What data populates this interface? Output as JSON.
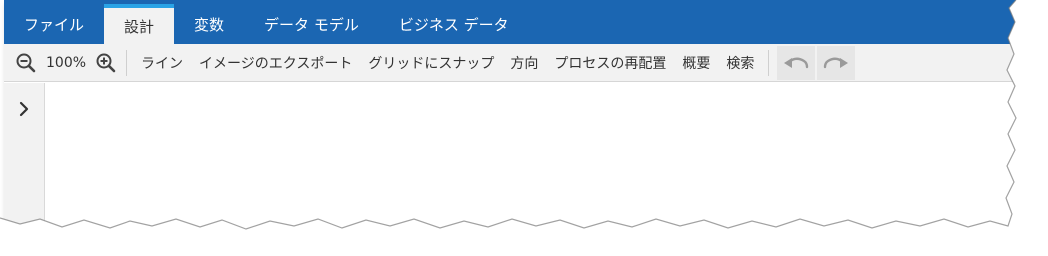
{
  "tabs": [
    {
      "label": "ファイル"
    },
    {
      "label": "設計"
    },
    {
      "label": "変数"
    },
    {
      "label": "データ モデル"
    },
    {
      "label": "ビジネス データ"
    }
  ],
  "toolbar": {
    "zoom_level": "100%",
    "buttons": [
      {
        "label": "ライン"
      },
      {
        "label": "イメージのエクスポート"
      },
      {
        "label": "グリッドにスナップ"
      },
      {
        "label": "方向"
      },
      {
        "label": "プロセスの再配置"
      },
      {
        "label": "概要"
      },
      {
        "label": "検索"
      }
    ],
    "icons": {
      "zoom_out": "zoom-out-icon",
      "zoom_in": "zoom-in-icon",
      "undo": "undo-icon",
      "redo": "redo-icon"
    }
  },
  "side_rail": {
    "toggle_icon": "chevron-right-icon"
  },
  "colors": {
    "tabbar": "#1b66b2",
    "active_tab_indicator": "#2aa3e6",
    "toolbar_bg": "#f2f2f2"
  }
}
